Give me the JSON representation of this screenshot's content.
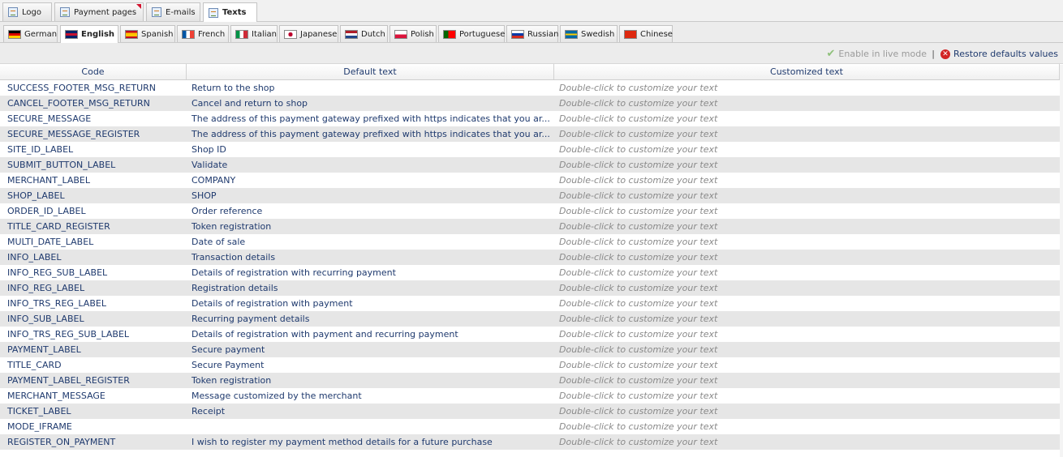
{
  "top_tabs": [
    {
      "label": "Logo",
      "icon": "image-icon",
      "active": false
    },
    {
      "label": "Payment pages",
      "icon": "page-edit-icon",
      "active": false,
      "marked": true
    },
    {
      "label": "E-mails",
      "icon": "email-edit-icon",
      "active": false
    },
    {
      "label": "Texts",
      "icon": "text-list-icon",
      "active": true
    }
  ],
  "languages": [
    {
      "label": "German",
      "flag": "flag-de"
    },
    {
      "label": "English",
      "flag": "flag-gb",
      "active": true
    },
    {
      "label": "Spanish",
      "flag": "flag-es"
    },
    {
      "label": "French",
      "flag": "flag-fr"
    },
    {
      "label": "Italian",
      "flag": "flag-it"
    },
    {
      "label": "Japanese",
      "flag": "flag-jp"
    },
    {
      "label": "Dutch",
      "flag": "flag-nl"
    },
    {
      "label": "Polish",
      "flag": "flag-pl"
    },
    {
      "label": "Portuguese",
      "flag": "flag-pt"
    },
    {
      "label": "Russian",
      "flag": "flag-ru"
    },
    {
      "label": "Swedish",
      "flag": "flag-se"
    },
    {
      "label": "Chinese",
      "flag": "flag-cn"
    }
  ],
  "toolbar": {
    "enable_live": "Enable in live mode",
    "separator": "|",
    "restore": "Restore defaults values"
  },
  "grid": {
    "columns": [
      "Code",
      "Default text",
      "Customized text"
    ],
    "placeholder": "Double-click to customize your text",
    "rows": [
      {
        "code": "SUCCESS_FOOTER_MSG_RETURN",
        "default": "Return to the shop"
      },
      {
        "code": "CANCEL_FOOTER_MSG_RETURN",
        "default": "Cancel and return to shop"
      },
      {
        "code": "SECURE_MESSAGE",
        "default": "The address of this payment gateway prefixed with https indicates that you ar..."
      },
      {
        "code": "SECURE_MESSAGE_REGISTER",
        "default": "The address of this payment gateway prefixed with https indicates that you ar..."
      },
      {
        "code": "SITE_ID_LABEL",
        "default": "Shop ID"
      },
      {
        "code": "SUBMIT_BUTTON_LABEL",
        "default": "Validate"
      },
      {
        "code": "MERCHANT_LABEL",
        "default": "COMPANY"
      },
      {
        "code": "SHOP_LABEL",
        "default": "SHOP"
      },
      {
        "code": "ORDER_ID_LABEL",
        "default": "Order reference"
      },
      {
        "code": "TITLE_CARD_REGISTER",
        "default": "Token registration"
      },
      {
        "code": "MULTI_DATE_LABEL",
        "default": "Date of sale"
      },
      {
        "code": "INFO_LABEL",
        "default": "Transaction details"
      },
      {
        "code": "INFO_REG_SUB_LABEL",
        "default": "Details of registration with recurring payment"
      },
      {
        "code": "INFO_REG_LABEL",
        "default": "Registration details"
      },
      {
        "code": "INFO_TRS_REG_LABEL",
        "default": "Details of registration with payment"
      },
      {
        "code": "INFO_SUB_LABEL",
        "default": "Recurring payment details"
      },
      {
        "code": "INFO_TRS_REG_SUB_LABEL",
        "default": "Details of registration with payment and recurring payment"
      },
      {
        "code": "PAYMENT_LABEL",
        "default": "Secure payment"
      },
      {
        "code": "TITLE_CARD",
        "default": "Secure Payment"
      },
      {
        "code": "PAYMENT_LABEL_REGISTER",
        "default": "Token registration"
      },
      {
        "code": "MERCHANT_MESSAGE",
        "default": "Message customized by the merchant"
      },
      {
        "code": "TICKET_LABEL",
        "default": "Receipt"
      },
      {
        "code": "MODE_IFRAME",
        "default": ""
      },
      {
        "code": "REGISTER_ON_PAYMENT",
        "default": "I wish to register my payment method details for a future purchase"
      }
    ]
  }
}
